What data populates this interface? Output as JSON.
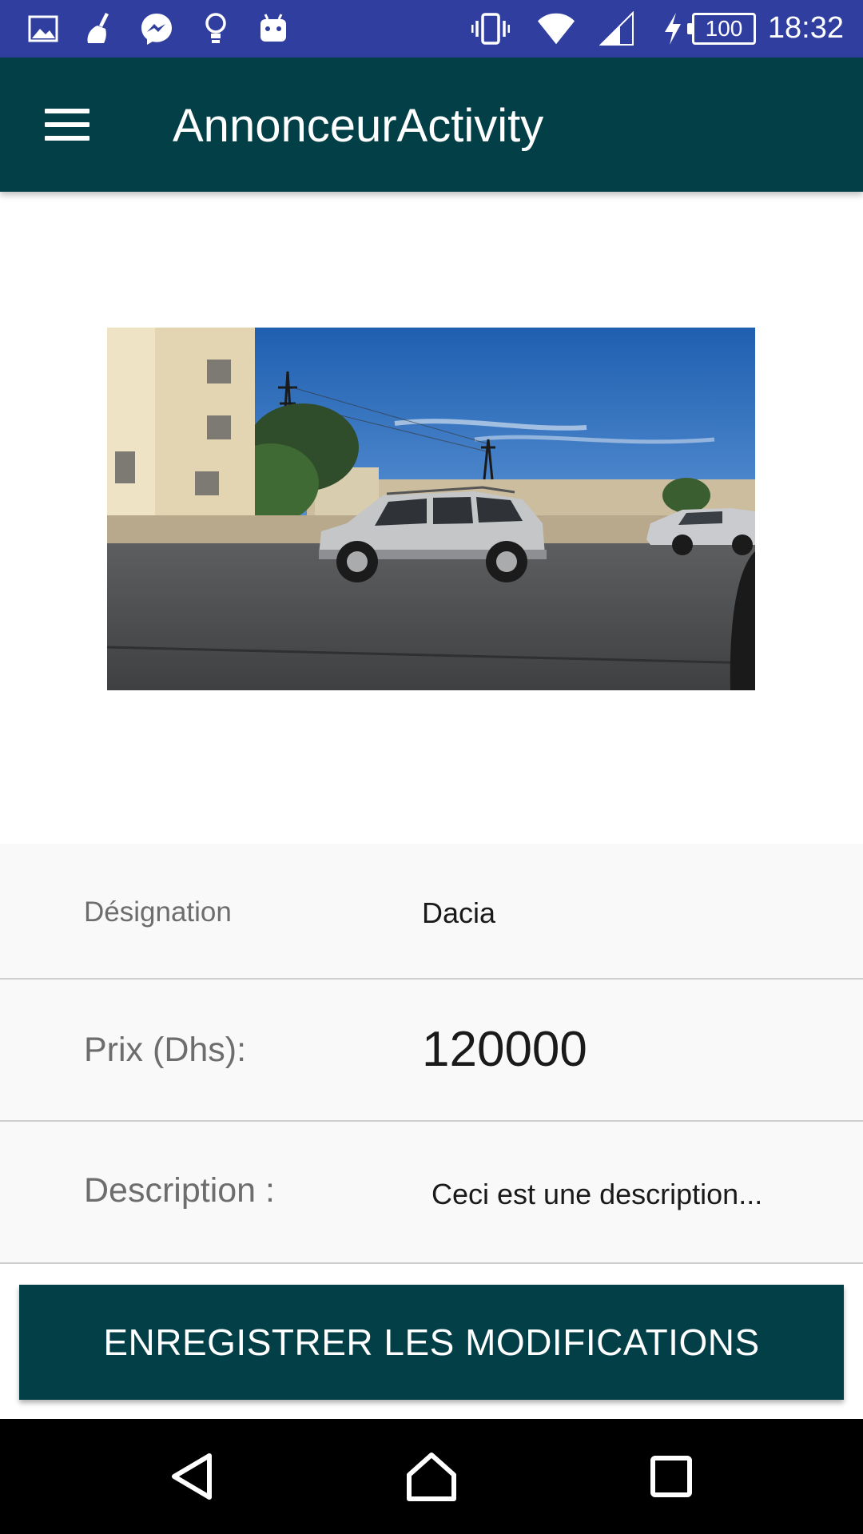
{
  "status_bar": {
    "time": "18:32",
    "battery_level": "100",
    "left_icons": [
      "gallery-icon",
      "cleaner-icon",
      "messenger-icon",
      "lightbulb-icon",
      "android-icon"
    ],
    "right_icons": [
      "vibrate-icon",
      "wifi-icon",
      "cell-signal-icon",
      "charging-icon",
      "battery-icon"
    ]
  },
  "app_bar": {
    "title": "AnnonceurActivity",
    "menu_icon": "hamburger-menu-icon"
  },
  "listing": {
    "photo_icon": "car-photo",
    "fields": [
      {
        "label": "Désignation",
        "value": "Dacia"
      },
      {
        "label": "Prix (Dhs):",
        "value": "120000"
      },
      {
        "label": "Description :",
        "value": "Ceci est une description..."
      }
    ]
  },
  "actions": {
    "save_label": "ENREGISTRER LES MODIFICATIONS"
  },
  "nav_bar": {
    "icons": [
      "back-icon",
      "home-icon",
      "recents-icon"
    ]
  },
  "colors": {
    "status_bar": "#303f9f",
    "primary": "#033f47",
    "row_background": "#f9f9f9",
    "nav_bar": "#000000"
  }
}
